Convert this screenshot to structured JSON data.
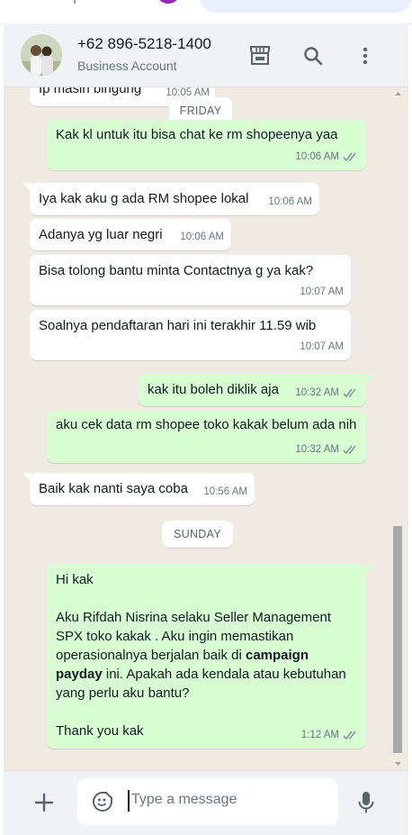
{
  "header": {
    "contact_number": "+62 896-5218-1400",
    "contact_subtitle": "Business Account"
  },
  "messages": [
    {
      "text": "Ip masih bingung",
      "time": "10:05 AM"
    },
    {
      "text": "Kak kl untuk itu bisa chat ke rm shopeenya yaa",
      "time": "10:06 AM"
    },
    {
      "text": "Iya kak aku g ada RM shopee lokal",
      "time": "10:06 AM"
    },
    {
      "text": "Adanya yg luar negri",
      "time": "10:06 AM"
    },
    {
      "text": "Bisa tolong bantu minta Contactnya g ya kak?",
      "time": "10:07 AM"
    },
    {
      "text": "Soalnya pendaftaran hari ini terakhir 11.59 wib",
      "time": "10:07 AM"
    },
    {
      "text": "kak itu boleh diklik aja",
      "time": "10:32 AM"
    },
    {
      "text": "aku cek data rm shopee toko kakak belum ada nih",
      "time": "10:32 AM"
    },
    {
      "text": "Baik kak nanti saya coba",
      "time": "10:56 AM"
    },
    {
      "greeting": "Hi kak",
      "body_start": "Aku Rifdah Nisrina selaku Seller Management SPX toko kakak . Aku ingin memastikan operasionalnya berjalan baik di",
      "bold_phrase": "campaign payday",
      "body_end": "ini. Apakah ada kendala atau kebutuhan yang perlu aku bantu?",
      "closing": "Thank you kak",
      "time": "1:12 AM"
    }
  ],
  "day_separators": [
    "FRIDAY",
    "SUNDAY"
  ],
  "composer": {
    "placeholder": "Type a message"
  },
  "icons": {
    "catalog": "storefront-icon",
    "search": "search-icon",
    "menu": "more-vertical-icon",
    "attach": "plus-icon",
    "emoji": "sticker-icon",
    "voice": "microphone-icon",
    "read_receipt": "double-check-icon"
  },
  "colors": {
    "incoming_bubble": "#ffffff",
    "outgoing_bubble": "#d9fdd3",
    "chat_background": "#efeae2",
    "header_background": "#f0f2f5"
  }
}
